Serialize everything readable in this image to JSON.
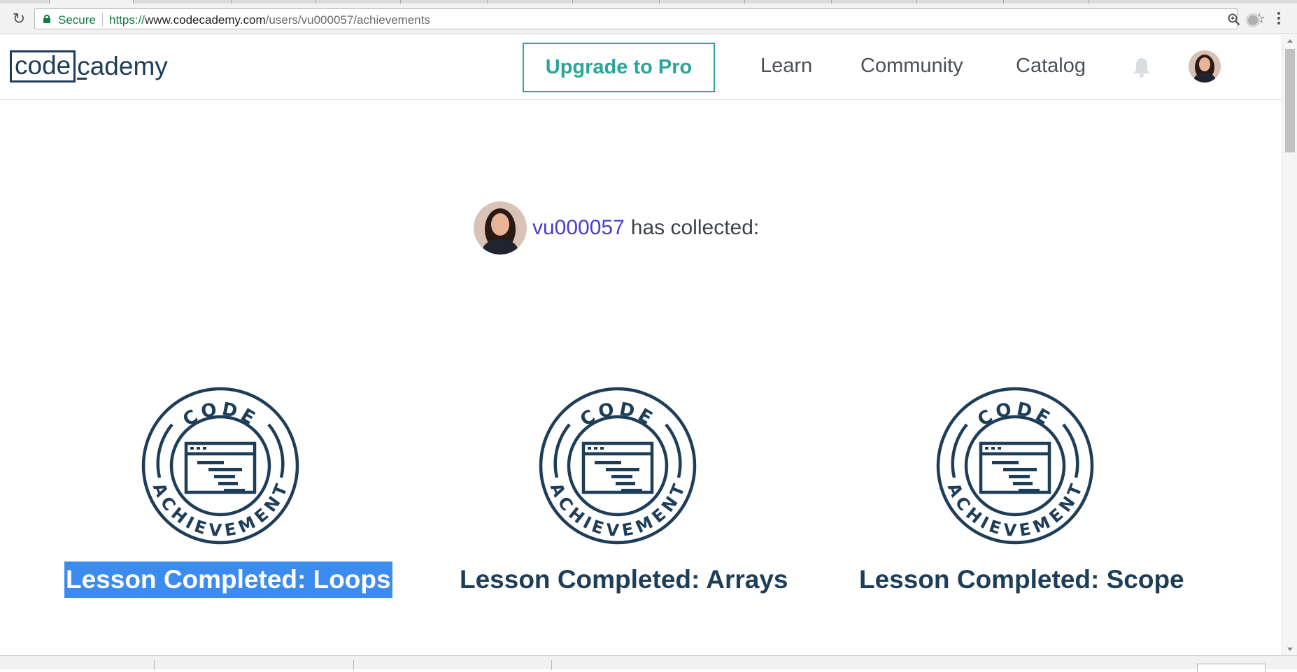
{
  "browser": {
    "secure_label": "Secure",
    "url_scheme": "https://",
    "url_host": "www.codecademy.com",
    "url_path": "/users/vu000057/achievements"
  },
  "header": {
    "logo_code": "code",
    "logo_cademy": "cademy",
    "upgrade_label": "Upgrade to Pro",
    "nav": {
      "learn": "Learn",
      "community": "Community",
      "catalog": "Catalog"
    }
  },
  "profile": {
    "username": "vu000057",
    "collected_text": "has collected:"
  },
  "badge": {
    "top_word": "CODE",
    "bottom_word": "ACHIEVEMENT"
  },
  "achievements": [
    {
      "title": "Lesson Completed: Loops",
      "selected": true
    },
    {
      "title": "Lesson Completed: Arrays",
      "selected": false
    },
    {
      "title": "Lesson Completed: Scope",
      "selected": false
    }
  ],
  "colors": {
    "navy": "#1d3d58",
    "teal": "#2ba59a",
    "username": "#4a3ec7",
    "selection": "#3c8bef"
  }
}
